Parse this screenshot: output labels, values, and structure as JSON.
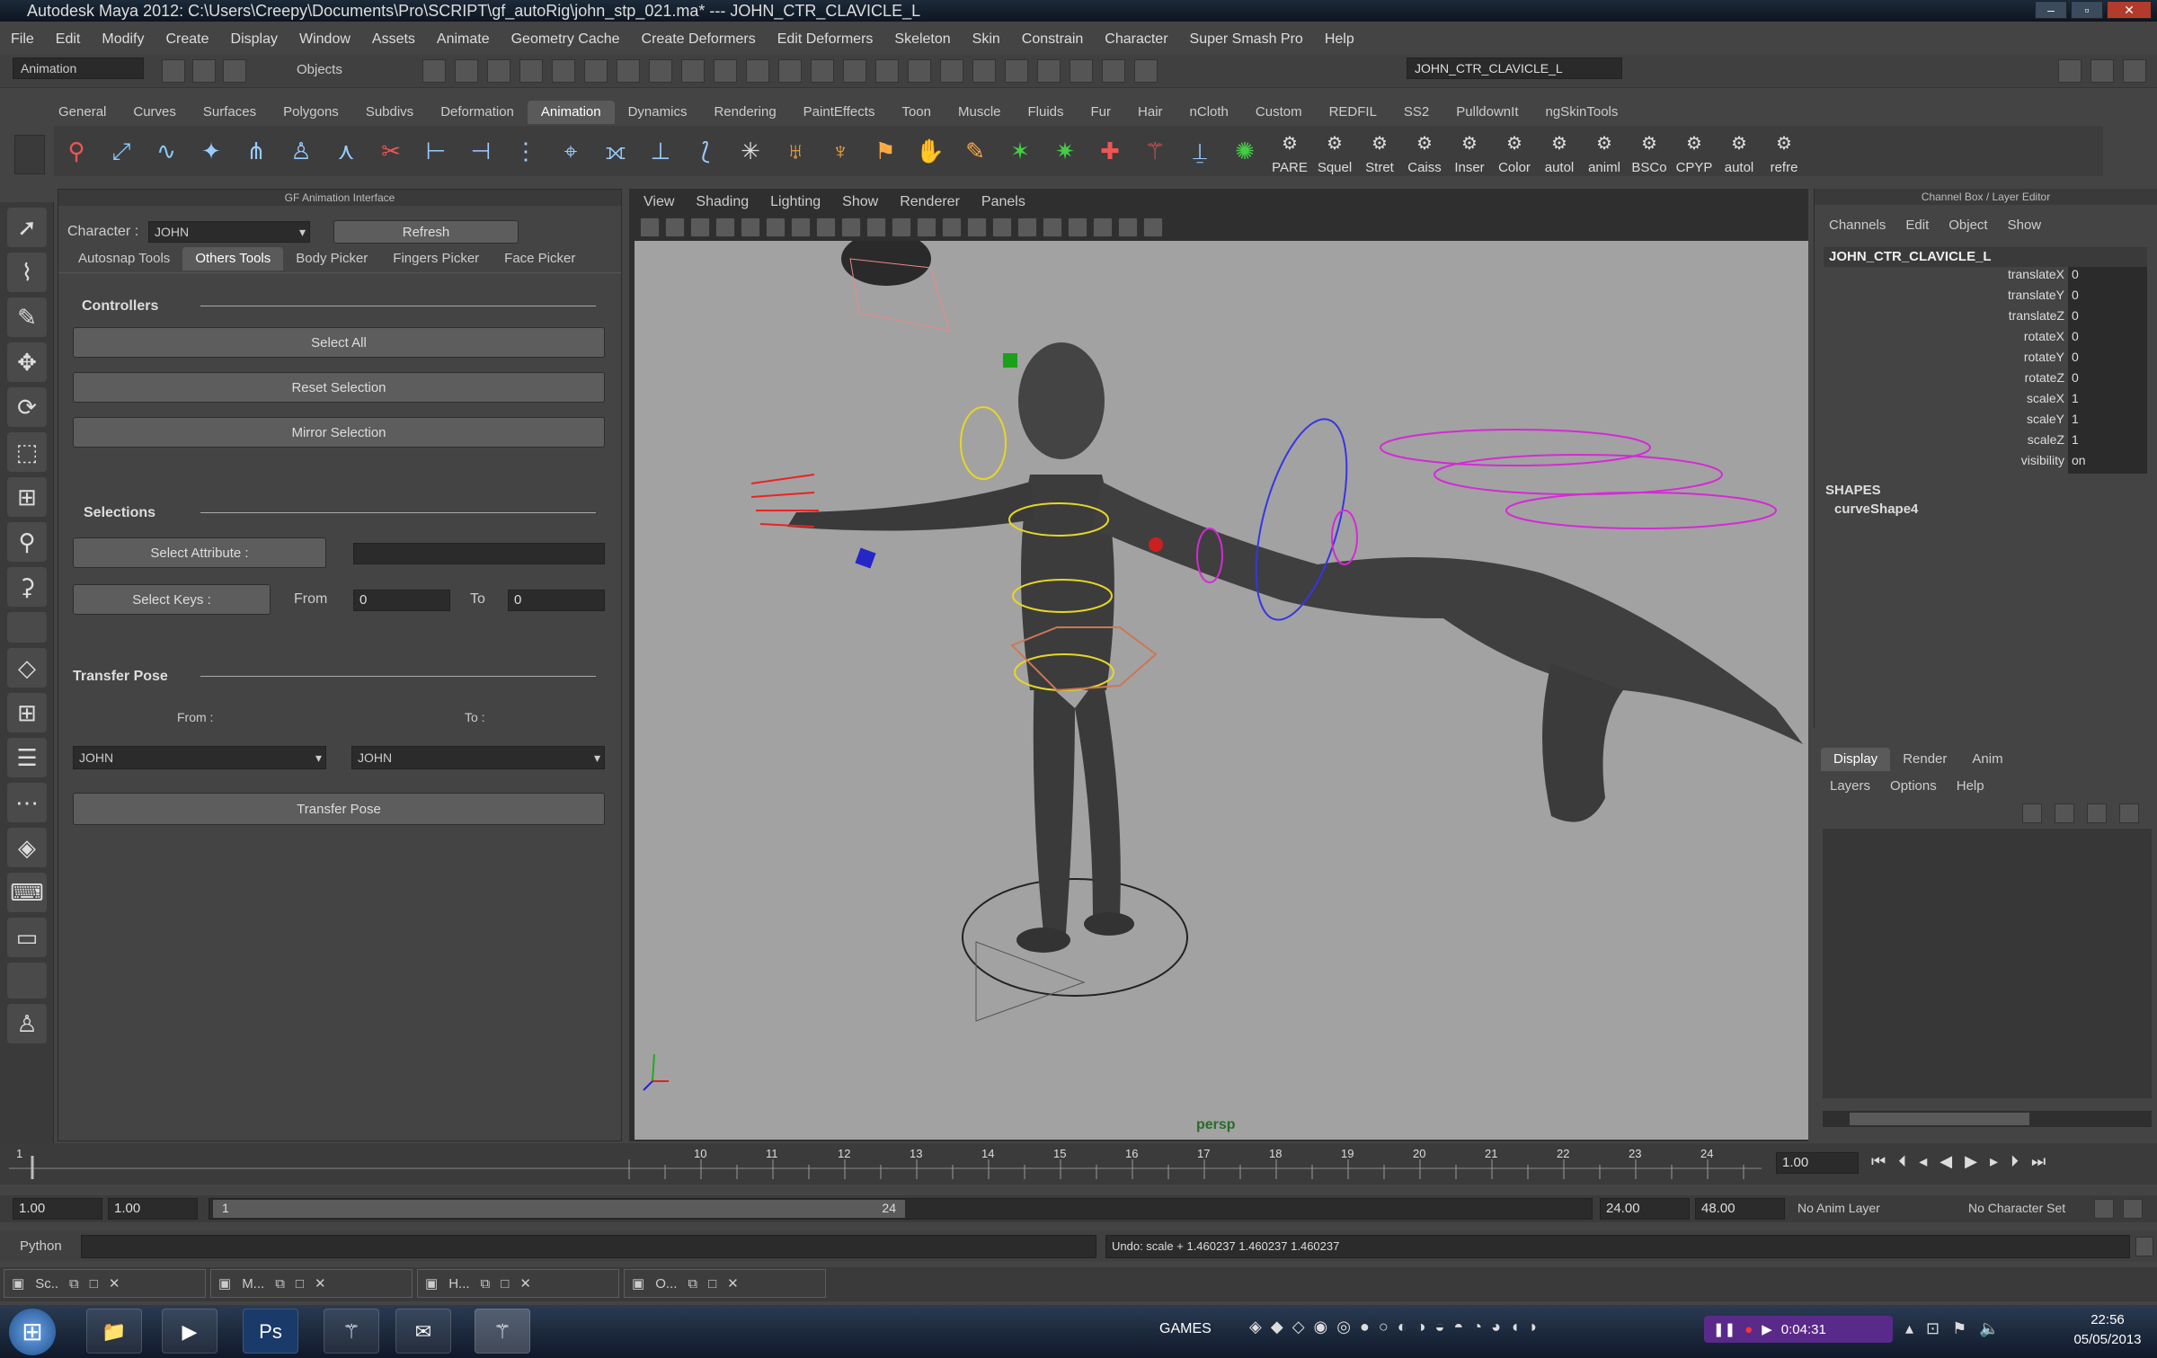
{
  "window": {
    "title": "Autodesk Maya 2012: C:\\Users\\Creepy\\Documents\\Pro\\SCRIPT\\gf_autoRig\\john_stp_021.ma*  ---  JOHN_CTR_CLAVICLE_L",
    "buttons": [
      "–",
      "▫",
      "✕"
    ]
  },
  "menubar": [
    "File",
    "Edit",
    "Modify",
    "Create",
    "Display",
    "Window",
    "Assets",
    "Animate",
    "Geometry Cache",
    "Create Deformers",
    "Edit Deformers",
    "Skeleton",
    "Skin",
    "Constrain",
    "Character",
    "Super Smash Pro",
    "Help"
  ],
  "statusline": {
    "mode": "Animation",
    "objects_label": "Objects",
    "name_field": "JOHN_CTR_CLAVICLE_L"
  },
  "shelf_tabs": [
    "General",
    "Curves",
    "Surfaces",
    "Polygons",
    "Subdivs",
    "Deformation",
    "Animation",
    "Dynamics",
    "Rendering",
    "PaintEffects",
    "Toon",
    "Muscle",
    "Fluids",
    "Fur",
    "Hair",
    "nCloth",
    "Custom",
    "REDFIL",
    "SS2",
    "PulldownIt",
    "ngSkinTools"
  ],
  "shelf_active_tab": "Animation",
  "shelf_labels": [
    "PARE",
    "Squel",
    "Stret",
    "Caiss",
    "Inser",
    "Color",
    "autol",
    "animl",
    "BSCo",
    "CPYP",
    "autol",
    "refre"
  ],
  "gf_panel": {
    "header": "GF Animation Interface",
    "character_label": "Character :",
    "character_value": "JOHN",
    "refresh_label": "Refresh",
    "tabs": [
      "Autosnap Tools",
      "Others Tools",
      "Body Picker",
      "Fingers Picker",
      "Face Picker"
    ],
    "active_tab": "Others Tools",
    "controllers_title": "Controllers",
    "select_all": "Select All",
    "reset_selection": "Reset Selection",
    "mirror_selection": "Mirror Selection",
    "selections_title": "Selections",
    "select_attribute": "Select Attribute :",
    "select_keys": "Select Keys :",
    "from_label": "From",
    "to_label": "To",
    "from_value": "0",
    "to_value": "0",
    "transfer_title": "Transfer Pose",
    "transfer_from_label": "From :",
    "transfer_to_label": "To :",
    "transfer_from_value": "JOHN",
    "transfer_to_value": "JOHN",
    "transfer_button": "Transfer Pose"
  },
  "viewport": {
    "menu": [
      "View",
      "Shading",
      "Lighting",
      "Show",
      "Renderer",
      "Panels"
    ],
    "camera_label": "persp"
  },
  "channel_box": {
    "header": "Channel Box / Layer Editor",
    "menu": [
      "Channels",
      "Edit",
      "Object",
      "Show"
    ],
    "object_name": "JOHN_CTR_CLAVICLE_L",
    "attributes": [
      {
        "name": "translateX",
        "value": "0"
      },
      {
        "name": "translateY",
        "value": "0"
      },
      {
        "name": "translateZ",
        "value": "0"
      },
      {
        "name": "rotateX",
        "value": "0"
      },
      {
        "name": "rotateY",
        "value": "0"
      },
      {
        "name": "rotateZ",
        "value": "0"
      },
      {
        "name": "scaleX",
        "value": "1"
      },
      {
        "name": "scaleY",
        "value": "1"
      },
      {
        "name": "scaleZ",
        "value": "1"
      },
      {
        "name": "visibility",
        "value": "on"
      }
    ],
    "shapes_title": "SHAPES",
    "shape_name": "curveShape4"
  },
  "layer_editor": {
    "tabs": [
      "Display",
      "Render",
      "Anim"
    ],
    "active_tab": "Display",
    "menu": [
      "Layers",
      "Options",
      "Help"
    ]
  },
  "timeline": {
    "ticks": [
      "1",
      "10",
      "11",
      "12",
      "13",
      "14",
      "15",
      "16",
      "17",
      "18",
      "19",
      "20",
      "21",
      "22",
      "23",
      "24"
    ],
    "current_frame": "1.00"
  },
  "range": {
    "start_field": "1.00",
    "start_field2": "1.00",
    "range_start": "1",
    "range_end": "24",
    "end_field": "24.00",
    "end_field2": "48.00",
    "anim_layer": "No Anim Layer",
    "character_set": "No Character Set"
  },
  "command_line": {
    "label": "Python",
    "result": "Undo: scale + 1.460237 1.460237 1.460237"
  },
  "task_panels": [
    "Sc..",
    "M...",
    "H...",
    "O..."
  ],
  "taskbar": {
    "games_label": "GAMES",
    "recorder_time": "0:04:31",
    "time": "22:56",
    "date": "05/05/2013"
  }
}
